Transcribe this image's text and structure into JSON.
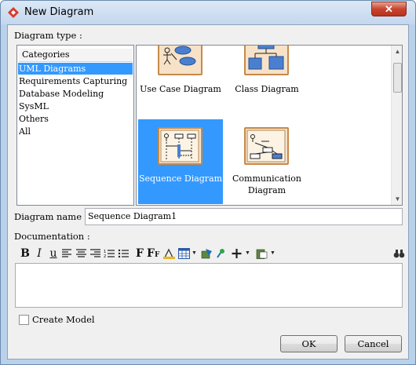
{
  "window": {
    "title": "New Diagram",
    "close_label": "✕"
  },
  "diagram_type": {
    "label": "Diagram type :",
    "categories_header": "Categories",
    "categories": [
      {
        "label": "UML Diagrams",
        "selected": true
      },
      {
        "label": "Requirements Capturing",
        "selected": false
      },
      {
        "label": "Database Modeling",
        "selected": false
      },
      {
        "label": "SysML",
        "selected": false
      },
      {
        "label": "Others",
        "selected": false
      },
      {
        "label": "All",
        "selected": false
      }
    ],
    "diagrams": [
      {
        "label": "Use Case Diagram",
        "selected": false
      },
      {
        "label": "Class Diagram",
        "selected": false
      },
      {
        "label": "Sequence Diagram",
        "selected": true
      },
      {
        "label": "Communication Diagram",
        "selected": false
      }
    ]
  },
  "diagram_name": {
    "label": "Diagram name :",
    "value": "Sequence Diagram1"
  },
  "documentation": {
    "label": "Documentation :",
    "value": "",
    "toolbar": {
      "bold": "B",
      "italic": "I",
      "underline": "u",
      "font": "F",
      "font_size": "F",
      "font_size_sub": "F"
    }
  },
  "create_model": {
    "label": "Create Model",
    "checked": false
  },
  "buttons": {
    "ok": "OK",
    "cancel": "Cancel"
  },
  "colors": {
    "selection": "#3399ff",
    "thumbnail_fill": "#f7e2c8",
    "thumbnail_border": "#c58a4a",
    "close_button": "#c7452f"
  }
}
